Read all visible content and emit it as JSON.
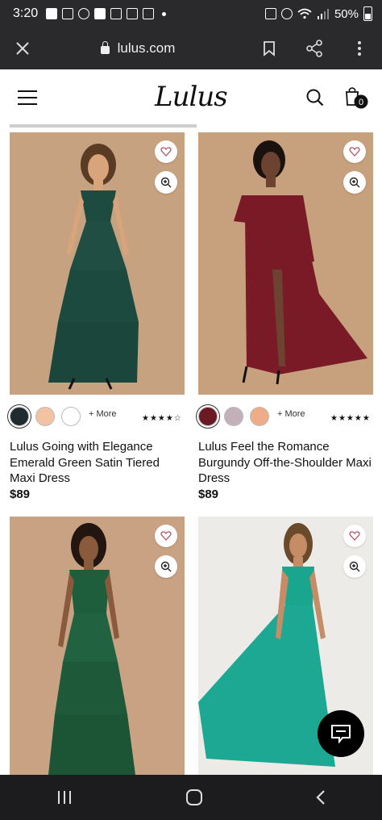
{
  "status": {
    "time": "3:20",
    "battery": "50%"
  },
  "browser": {
    "url": "lulus.com"
  },
  "site": {
    "logo": "Lulus",
    "cart_count": "0"
  },
  "products": [
    {
      "name": "Lulus Going with Elegance Emerald Green Satin Tiered Maxi Dress",
      "price": "$89",
      "more_label": "+ More",
      "stars": "★★★★☆",
      "swatches": [
        "#1f2b2e",
        "#f3c2a2",
        "#ffffff"
      ],
      "dress_color": "#1e4b40"
    },
    {
      "name": "Lulus Feel the Romance Burgundy Off-the-Shoulder Maxi Dress",
      "price": "$89",
      "more_label": "+ More",
      "stars": "★★★★★",
      "swatches": [
        "#6b1a24",
        "#c4b0b9",
        "#eeac88"
      ],
      "dress_color": "#7a1a26"
    },
    {
      "dress_color": "#1f5e3c"
    },
    {
      "dress_color": "#1aa58f"
    }
  ]
}
